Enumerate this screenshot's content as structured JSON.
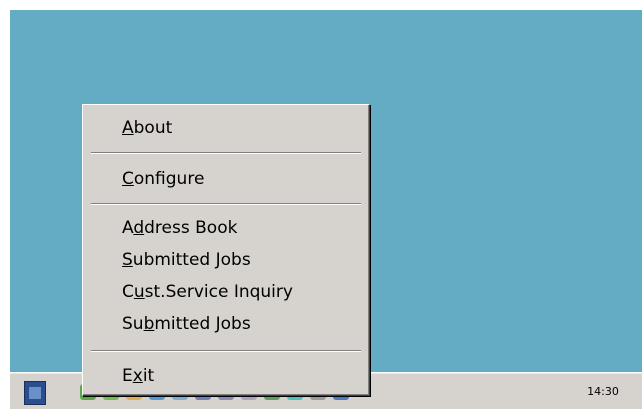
{
  "context_menu": {
    "items": [
      {
        "pre": "",
        "key": "A",
        "post": "bout"
      },
      {
        "pre": "",
        "key": "C",
        "post": "onfigure"
      },
      {
        "pre": "A",
        "key": "d",
        "post": "dress Book"
      },
      {
        "pre": "",
        "key": "S",
        "post": "ubmitted Jobs"
      },
      {
        "pre": "C",
        "key": "u",
        "post": "st.Service Inquiry"
      },
      {
        "pre": "Su",
        "key": "b",
        "post": "mitted Jobs"
      },
      {
        "pre": "E",
        "key": "x",
        "post": "it"
      }
    ]
  },
  "taskbar": {
    "clock": "14:30",
    "tray_icons": [
      {
        "name": "app-icon",
        "color": "#5aa84a"
      },
      {
        "name": "app-icon",
        "color": "#6fbf4a"
      },
      {
        "name": "app-icon",
        "color": "#e0b050"
      },
      {
        "name": "app-icon",
        "color": "#4c9be0"
      },
      {
        "name": "app-icon",
        "color": "#7ab0d8"
      },
      {
        "name": "app-icon",
        "color": "#6d7fc4"
      },
      {
        "name": "app-icon",
        "color": "#8a8ab4"
      },
      {
        "name": "app-icon",
        "color": "#b0a0c0"
      },
      {
        "name": "app-icon",
        "color": "#5ca060"
      },
      {
        "name": "app-icon",
        "color": "#4fc0c0"
      },
      {
        "name": "app-icon",
        "color": "#9a9a9a"
      },
      {
        "name": "app-icon",
        "color": "#4a7ac4"
      }
    ]
  },
  "colors": {
    "desktop": "#64abc4",
    "menu_background": "#d6d3ce"
  }
}
